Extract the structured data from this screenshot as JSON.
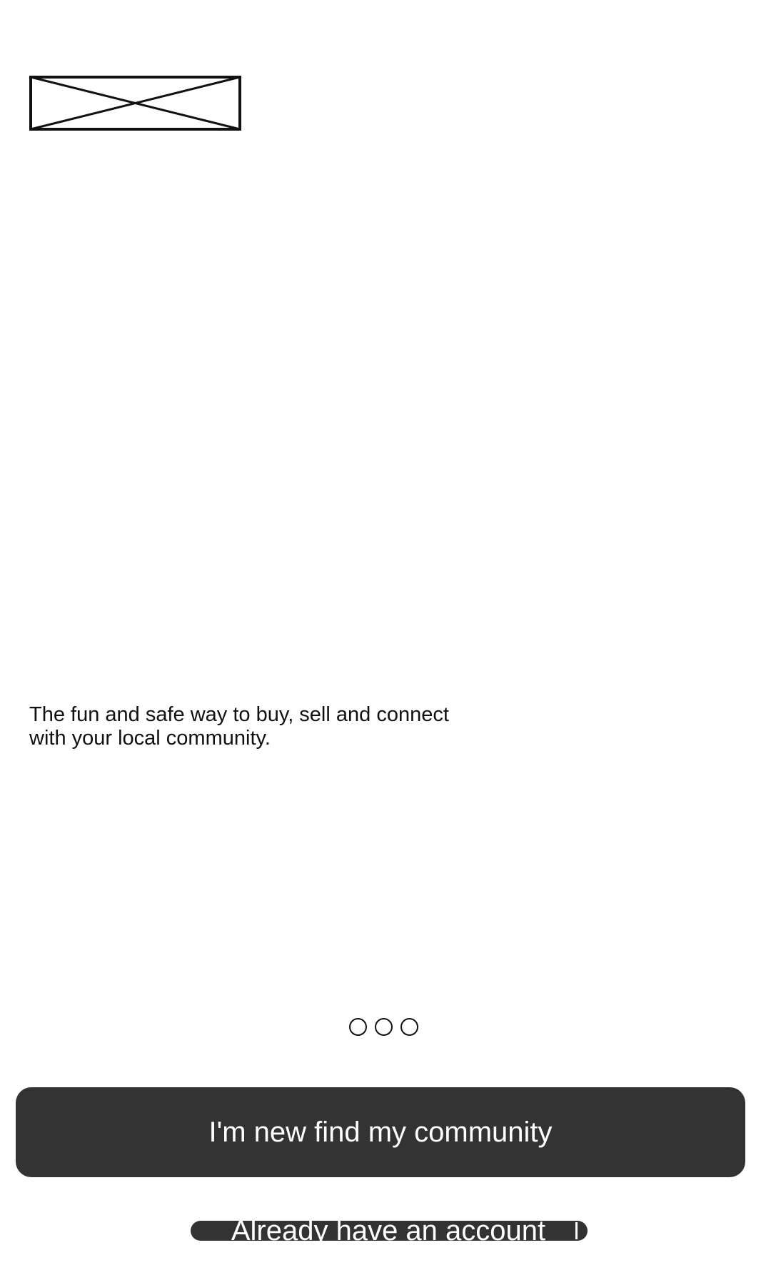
{
  "logo": {
    "icon": "image-placeholder-icon"
  },
  "onboarding": {
    "tagline": "The fun and safe way to buy, sell and connect\nwith your local community.",
    "pager": {
      "total_pages": 3,
      "current_page": null
    }
  },
  "actions": {
    "primary_label": "I'm new find my community",
    "secondary_label": "Already have an account"
  },
  "colors": {
    "button_background": "#333333",
    "button_text": "#ffffff",
    "page_background": "#ffffff"
  }
}
